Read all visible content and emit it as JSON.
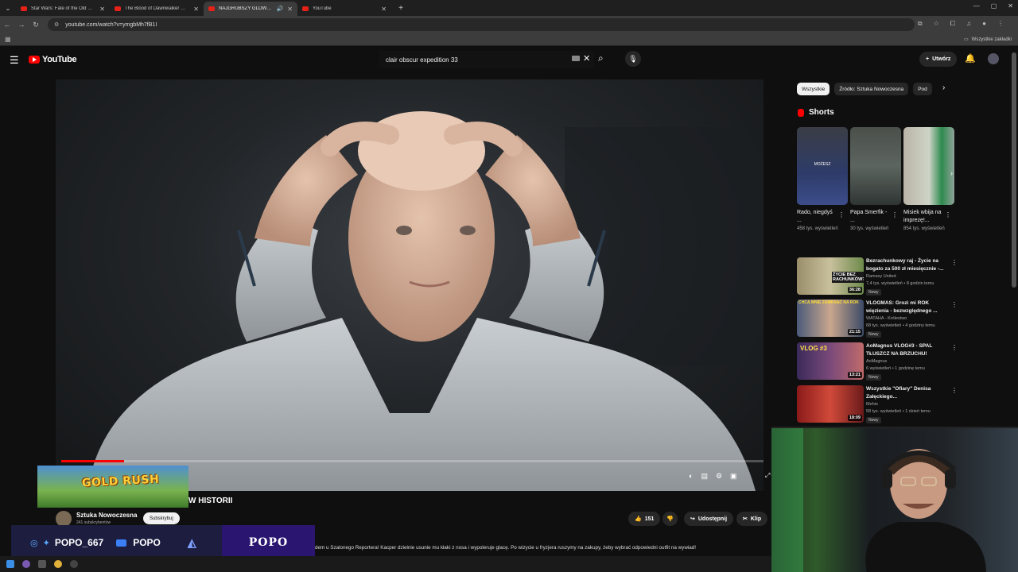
{
  "browser": {
    "tabs": [
      {
        "title": "Star Wars: Fate of the Old Repu",
        "active": false,
        "audio": false
      },
      {
        "title": "The Blood of Dawnwalker — Pr",
        "active": false,
        "audio": false
      },
      {
        "title": "NAJGRUBSZY GLOW UP R",
        "active": true,
        "audio": true
      },
      {
        "title": "YouTube",
        "active": false,
        "audio": false
      }
    ],
    "url": "youtube.com/watch?v=ymgbMh7fB1I",
    "bookmarks_label": "Wszystkie zakładki"
  },
  "youtube": {
    "logo_text": "YouTube",
    "search_value": "clair obscur expedition 33",
    "create_label": "Utwórz"
  },
  "video": {
    "title_visible": "W HISTORII",
    "progress": 0.09,
    "channel": "Sztuka Nowoczesna",
    "subscribers": "241 subskrybentów",
    "subscribe_label": "Subskrybuj",
    "likes": "151",
    "share_label": "Udostępnij",
    "clip_label": "Klip",
    "description": "dem u Szalonego Reportera! Kacper dzielnie usunie mu kłaki z nosa i wypoleruje glacę. Po wizycie u fryzjera ruszymy na zakupy, żeby wybrać odpowiedni outfit na wywiad!"
  },
  "sidebar": {
    "chips": [
      "Wszystkie",
      "Źródło: Sztuka Nowoczesna",
      "Pod"
    ],
    "shorts_heading": "Shorts",
    "shorts": [
      {
        "title": "Rado, niegdyś ...",
        "views": "458 tys. wyświetleń",
        "thumb_text": "MOŻESZ"
      },
      {
        "title": "Papa Smerfik - ...",
        "views": "30 tys. wyświetleń",
        "thumb_text": ""
      },
      {
        "title": "Misiek wbija na imprezę!...",
        "views": "854 tys. wyświetleń",
        "thumb_text": ""
      }
    ],
    "recommendations": [
      {
        "title": "Bezrachunkowy raj - Życie na bogato za 500 zł miesięcznie -...",
        "channel": "Ramsey United",
        "meta": "7,4 tys. wyświetleń • 8 godzin temu",
        "badge": "Nowy",
        "duration": "36:28",
        "thumb_text": "ŻYCIE BEZ RACHUNKÓW?"
      },
      {
        "title": "VLOGMAS: Grozi mi ROK więzienia - bezwzględnego ...",
        "channel": "WATAHA - Królestwo",
        "meta": "68 tys. wyświetleń • 4 godziny temu",
        "badge": "Nowy",
        "duration": "21:15",
        "thumb_text": "CHCĄ MNIE ZAMKNĄĆ NA ROK"
      },
      {
        "title": "AoMagnus VLOG#3 - SPAL TŁUSZCZ NA BRZUCHU!",
        "channel": "AoMagnus",
        "meta": "6 wyświetleń • 1 godzinę temu",
        "badge": "Nowy",
        "duration": "13:21",
        "thumb_text": "VLOG #3"
      },
      {
        "title": "Wszystkie \"Ofiary\" Denisa Załęckiego...",
        "channel": "Mehio",
        "meta": "58 tys. wyświetleń • 1 dzień temu",
        "badge": "Nowy",
        "duration": "18:09",
        "thumb_text": ""
      }
    ]
  },
  "overlay": {
    "game_banner": "GOLD RUSH",
    "handle_1": "POPO_667",
    "handle_2": "POPO",
    "brand": "POPO"
  },
  "colors": {
    "yt_red": "#ff0000",
    "background": "#0f0f0f",
    "overlay_bar": "#1c1d3f",
    "overlay_brand": "#2a1670"
  }
}
